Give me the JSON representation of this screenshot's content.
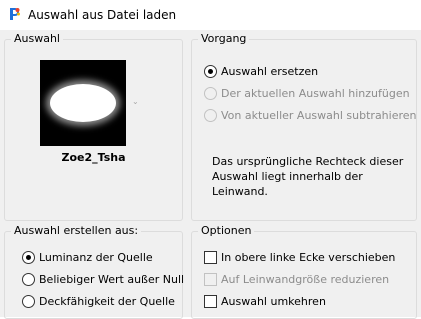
{
  "window": {
    "title": "Auswahl aus Datei laden",
    "icon": "psp-app-icon"
  },
  "auswahl_group": {
    "label": "Auswahl",
    "preview_name": "Zoe2_Tsha",
    "preview_arrow": "⌄"
  },
  "vorgang_group": {
    "label": "Vorgang",
    "options": [
      {
        "label": "Auswahl ersetzen",
        "checked": true,
        "enabled": true
      },
      {
        "label": "Der aktuellen Auswahl hinzufügen",
        "checked": false,
        "enabled": false
      },
      {
        "label": "Von aktueller Auswahl subtrahieren",
        "checked": false,
        "enabled": false
      }
    ],
    "info": "Das ursprüngliche Rechteck dieser Auswahl liegt innerhalb der Leinwand."
  },
  "erstellen_group": {
    "label": "Auswahl erstellen aus:",
    "options": [
      {
        "label": "Luminanz der Quelle",
        "checked": true
      },
      {
        "label": "Beliebiger Wert außer Null",
        "checked": false
      },
      {
        "label": "Deckfähigkeit der Quelle",
        "checked": false
      }
    ]
  },
  "optionen_group": {
    "label": "Optionen",
    "options": [
      {
        "label": "In obere linke Ecke verschieben",
        "checked": false,
        "enabled": true
      },
      {
        "label": "Auf Leinwandgröße reduzieren",
        "checked": false,
        "enabled": false
      },
      {
        "label": "Auswahl umkehren",
        "checked": false,
        "enabled": true
      }
    ]
  }
}
